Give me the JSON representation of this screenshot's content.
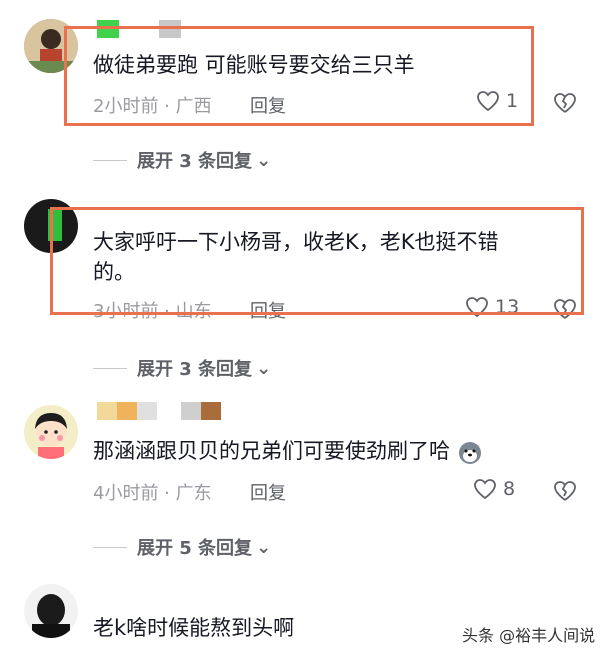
{
  "comments": [
    {
      "text": "做徒弟要跑 可能账号要交给三只羊",
      "time_location": "2小时前 · 广西",
      "reply_label": "回复",
      "likes": "1",
      "expand_label": "展开 3 条回复"
    },
    {
      "text": "大家呼吁一下小杨哥，收老K，老K也挺不错的。",
      "time_location": "3小时前 · 山东",
      "reply_label": "回复",
      "likes": "13",
      "expand_label": "展开 3 条回复"
    },
    {
      "text": "那涵涵跟贝贝的兄弟们可要使劲刷了哈",
      "time_location": "4小时前 · 广东",
      "reply_label": "回复",
      "likes": "8",
      "expand_label": "展开 5 条回复"
    },
    {
      "text": "老k啥时候能熬到头啊"
    }
  ],
  "watermark": "头条 @裕丰人间说",
  "colors": {
    "highlight": "#e9714f",
    "text": "#161823",
    "meta": "#9a9ba0"
  }
}
